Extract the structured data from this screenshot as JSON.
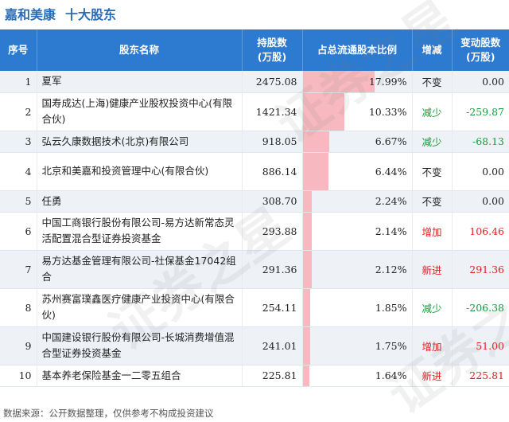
{
  "title": {
    "company": "嘉和美康",
    "subtitle": "十大股东"
  },
  "header": {
    "rank": "序号",
    "name": "股东名称",
    "shares_l1": "持股数",
    "shares_l2": "(万股)",
    "ratio": "占总流通股本比例",
    "change": "增减",
    "amount_l1": "变动股数",
    "amount_l2": "(万股)"
  },
  "rows": [
    {
      "rank": "1",
      "name": "夏军",
      "shares": "2475.08",
      "ratio": "17.99%",
      "ratio_value": 17.99,
      "change": "不变",
      "amount": "0.00",
      "color": "black"
    },
    {
      "rank": "2",
      "name": "国寿成达(上海)健康产业股权投资中心(有限合伙)",
      "shares": "1421.34",
      "ratio": "10.33%",
      "ratio_value": 10.33,
      "change": "减少",
      "amount": "-259.87",
      "color": "green"
    },
    {
      "rank": "3",
      "name": "弘云久康数据技术(北京)有限公司",
      "shares": "918.05",
      "ratio": "6.67%",
      "ratio_value": 6.67,
      "change": "减少",
      "amount": "-68.13",
      "color": "green"
    },
    {
      "rank": "4",
      "name": "北京和美嘉和投资管理中心(有限合伙)",
      "shares": "886.14",
      "ratio": "6.44%",
      "ratio_value": 6.44,
      "change": "不变",
      "amount": "0.00",
      "color": "black"
    },
    {
      "rank": "5",
      "name": "任勇",
      "shares": "308.70",
      "ratio": "2.24%",
      "ratio_value": 2.24,
      "change": "不变",
      "amount": "0.00",
      "color": "black"
    },
    {
      "rank": "6",
      "name": "中国工商银行股份有限公司-易方达新常态灵活配置混合型证券投资基金",
      "shares": "293.88",
      "ratio": "2.14%",
      "ratio_value": 2.14,
      "change": "增加",
      "amount": "106.46",
      "color": "red"
    },
    {
      "rank": "7",
      "name": "易方达基金管理有限公司-社保基金17042组合",
      "shares": "291.36",
      "ratio": "2.12%",
      "ratio_value": 2.12,
      "change": "新进",
      "amount": "291.36",
      "color": "red"
    },
    {
      "rank": "8",
      "name": "苏州赛富璞鑫医疗健康产业投资中心(有限合伙)",
      "shares": "254.11",
      "ratio": "1.85%",
      "ratio_value": 1.85,
      "change": "减少",
      "amount": "-206.38",
      "color": "green"
    },
    {
      "rank": "9",
      "name": "中国建设银行股份有限公司-长城消费增值混合型证券投资基金",
      "shares": "241.01",
      "ratio": "1.75%",
      "ratio_value": 1.75,
      "change": "增加",
      "amount": "51.00",
      "color": "red"
    },
    {
      "rank": "10",
      "name": "基本养老保险基金一二零五组合",
      "shares": "225.81",
      "ratio": "1.64%",
      "ratio_value": 1.64,
      "change": "新进",
      "amount": "225.81",
      "color": "red"
    }
  ],
  "footer": "数据来源：公开数据整理，仅供参考不构成投资建议",
  "watermark_text": "证券之星"
}
